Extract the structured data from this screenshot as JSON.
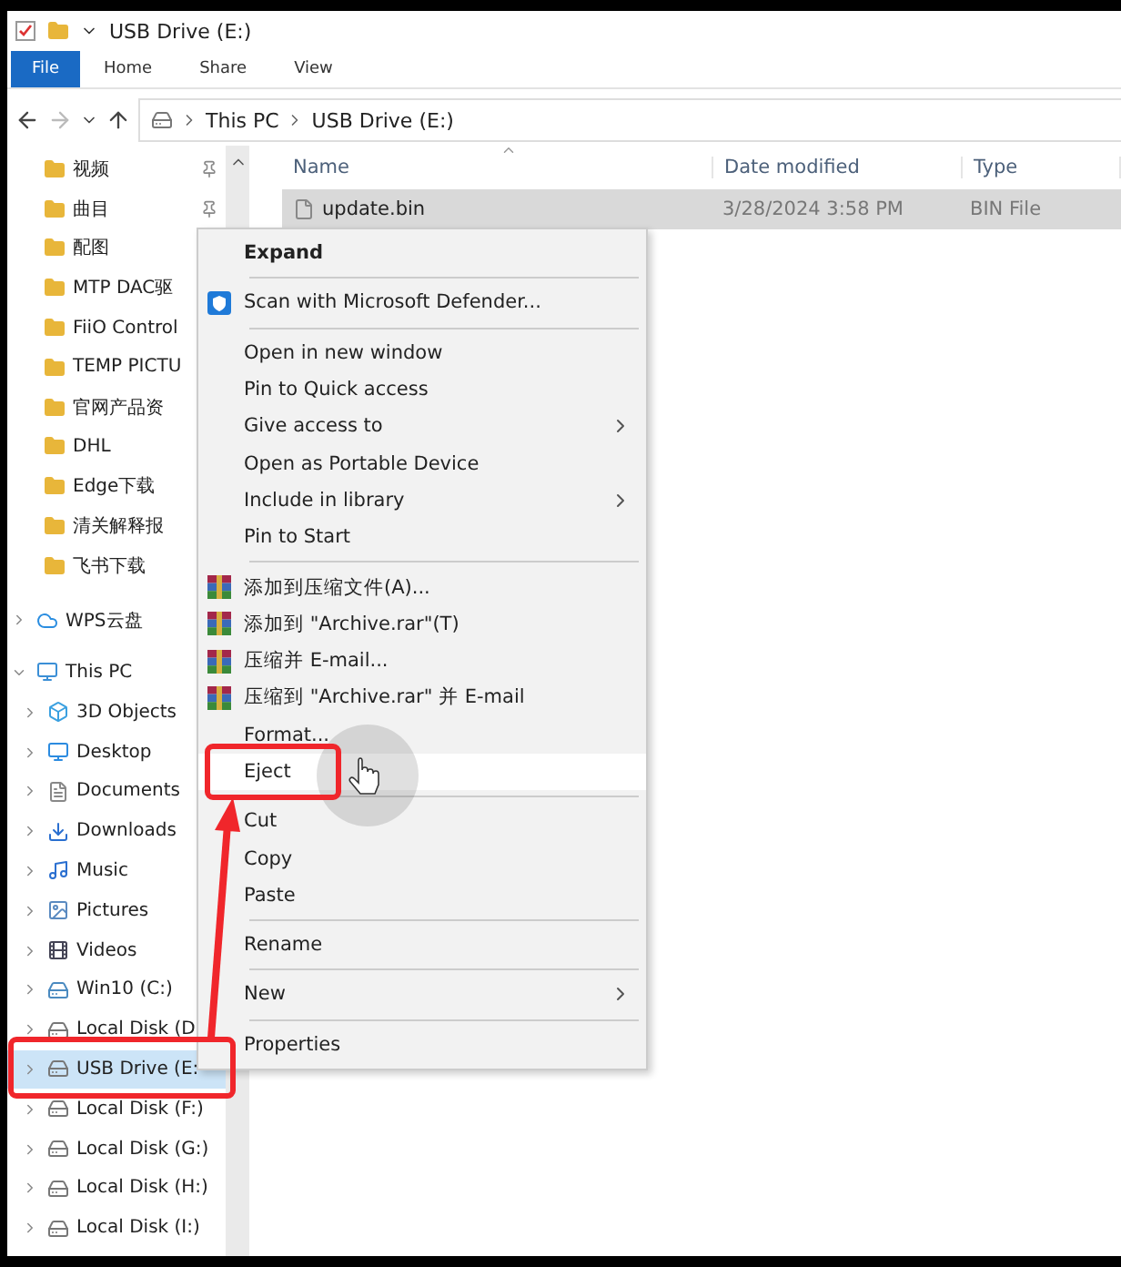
{
  "window": {
    "title": "USB Drive (E:)"
  },
  "ribbon_tabs": [
    {
      "label": "File",
      "selected": true
    },
    {
      "label": "Home",
      "selected": false
    },
    {
      "label": "Share",
      "selected": false
    },
    {
      "label": "View",
      "selected": false
    }
  ],
  "address_bar": {
    "path": [
      "This PC",
      "USB Drive (E:)"
    ]
  },
  "navigation": {
    "items": [
      {
        "label": "视频",
        "kind": "folder",
        "pinned": true,
        "selected": false
      },
      {
        "label": "曲目",
        "kind": "folder",
        "pinned": true,
        "selected": false
      },
      {
        "label": "配图",
        "kind": "folder",
        "selected": false
      },
      {
        "label": "MTP DAC驱",
        "kind": "folder",
        "selected": false
      },
      {
        "label": "FiiO Control",
        "kind": "folder",
        "selected": false
      },
      {
        "label": "TEMP PICTU",
        "kind": "folder",
        "selected": false
      },
      {
        "label": "官网产品资",
        "kind": "folder",
        "selected": false
      },
      {
        "label": "DHL",
        "kind": "folder",
        "selected": false
      },
      {
        "label": "Edge下载",
        "kind": "folder",
        "selected": false
      },
      {
        "label": "清关解释报",
        "kind": "folder",
        "selected": false
      },
      {
        "label": "飞书下载",
        "kind": "folder",
        "selected": false
      },
      {
        "label": "WPS云盘",
        "kind": "cloud",
        "expanded": false,
        "selected": false
      },
      {
        "label": "This PC",
        "kind": "pc",
        "expanded": true,
        "selected": false,
        "children": [
          {
            "label": "3D Objects",
            "kind": "objects",
            "expanded": false,
            "selected": false
          },
          {
            "label": "Desktop",
            "kind": "desktop",
            "expanded": false,
            "selected": false
          },
          {
            "label": "Documents",
            "kind": "documents",
            "expanded": false,
            "selected": false
          },
          {
            "label": "Downloads",
            "kind": "downloads",
            "expanded": false,
            "selected": false
          },
          {
            "label": "Music",
            "kind": "music",
            "expanded": false,
            "selected": false
          },
          {
            "label": "Pictures",
            "kind": "pictures",
            "expanded": false,
            "selected": false
          },
          {
            "label": "Videos",
            "kind": "videos",
            "expanded": false,
            "selected": false
          },
          {
            "label": "Win10 (C:)",
            "kind": "system-drive",
            "expanded": false,
            "selected": false
          },
          {
            "label": "Local Disk (D",
            "kind": "drive",
            "expanded": false,
            "selected": false
          },
          {
            "label": "USB Drive (E:",
            "kind": "drive",
            "expanded": false,
            "selected": true
          },
          {
            "label": "Local Disk (F:)",
            "kind": "drive",
            "expanded": false,
            "selected": false
          },
          {
            "label": "Local Disk (G:)",
            "kind": "drive",
            "expanded": false,
            "selected": false
          },
          {
            "label": "Local Disk (H:)",
            "kind": "drive",
            "expanded": false,
            "selected": false
          },
          {
            "label": "Local Disk (I:)",
            "kind": "drive",
            "expanded": false,
            "selected": false
          }
        ]
      }
    ]
  },
  "file_list": {
    "columns": [
      "Name",
      "Date modified",
      "Type"
    ],
    "rows": [
      {
        "name": "update.bin",
        "date_modified": "3/28/2024 3:58 PM",
        "type": "BIN File",
        "selected": true
      }
    ]
  },
  "context_menu": {
    "items": [
      {
        "kind": "header",
        "label": "Expand",
        "highlighted": false
      },
      {
        "kind": "separator"
      },
      {
        "kind": "defender",
        "label": "Scan with Microsoft Defender...",
        "highlighted": false
      },
      {
        "kind": "separator"
      },
      {
        "kind": "item",
        "label": "Open in new window",
        "highlighted": false
      },
      {
        "kind": "item",
        "label": "Pin to Quick access",
        "highlighted": false
      },
      {
        "kind": "item",
        "label": "Give access to",
        "submenu": true,
        "highlighted": false
      },
      {
        "kind": "item",
        "label": "Open as Portable Device",
        "highlighted": false
      },
      {
        "kind": "item",
        "label": "Include in library",
        "submenu": true,
        "highlighted": false
      },
      {
        "kind": "item",
        "label": "Pin to Start",
        "highlighted": false
      },
      {
        "kind": "separator"
      },
      {
        "kind": "archive",
        "label": "添加到压缩文件(A)...",
        "highlighted": false
      },
      {
        "kind": "archive",
        "label": "添加到 \"Archive.rar\"(T)",
        "highlighted": false
      },
      {
        "kind": "archive",
        "label": "压缩并 E-mail...",
        "highlighted": false
      },
      {
        "kind": "archive",
        "label": "压缩到 \"Archive.rar\" 并 E-mail",
        "highlighted": false
      },
      {
        "kind": "item",
        "label": "Format...",
        "highlighted": false
      },
      {
        "kind": "item",
        "label": "Eject",
        "highlighted": true
      },
      {
        "kind": "separator"
      },
      {
        "kind": "item",
        "label": "Cut",
        "highlighted": false
      },
      {
        "kind": "item",
        "label": "Copy",
        "highlighted": false
      },
      {
        "kind": "item",
        "label": "Paste",
        "highlighted": false
      },
      {
        "kind": "separator"
      },
      {
        "kind": "item",
        "label": "Rename",
        "highlighted": false
      },
      {
        "kind": "separator"
      },
      {
        "kind": "item",
        "label": "New",
        "submenu": true,
        "highlighted": false
      },
      {
        "kind": "separator"
      },
      {
        "kind": "item",
        "label": "Properties",
        "highlighted": false
      }
    ]
  }
}
